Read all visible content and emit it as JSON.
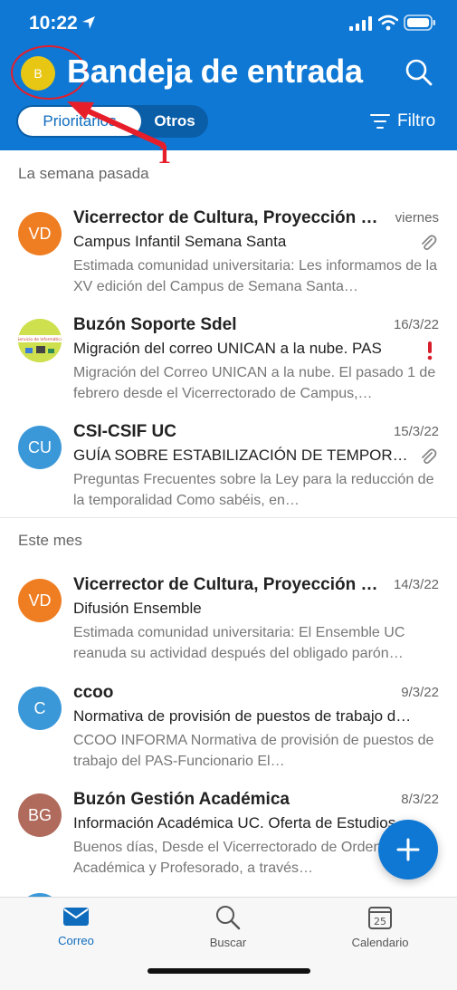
{
  "status_bar": {
    "time": "10:22"
  },
  "header": {
    "avatar_initial": "B",
    "title": "Bandeja de entrada",
    "segments": [
      "Prioritarios",
      "Otros"
    ],
    "filter_label": "Filtro"
  },
  "annotation": {
    "number": "1",
    "color": "#e61e2a"
  },
  "sections": [
    {
      "title": "La semana pasada"
    },
    {
      "title": "Este mes"
    }
  ],
  "emails": [
    {
      "initials": "VD",
      "avatar_color": "#ef7d22",
      "sender": "Vicerrector de Cultura, Proyección Social",
      "date": "viernes",
      "subject": "Campus Infantil Semana Santa",
      "preview": "Estimada comunidad universitaria: Les informamos de la XV edición del Campus de Semana Santa…",
      "attachment": true,
      "important": false
    },
    {
      "initials": "",
      "avatar_color": "#c8d94a",
      "avatar_image_text": "Servicio de Informática",
      "sender": "Buzón Soporte Sdel",
      "date": "16/3/22",
      "subject": " Migración del correo UNICAN a la nube. PAS",
      "preview": "Migración del Correo UNICAN a la nube. El pasado 1 de febrero desde el Vicerrectorado de Campus,…",
      "attachment": false,
      "important": true
    },
    {
      "initials": "CU",
      "avatar_color": "#3b98d8",
      "sender": "CSI-CSIF UC",
      "date": "15/3/22",
      "subject": "GUÍA SOBRE ESTABILIZACIÓN DE TEMPORALIDAD",
      "preview": "Preguntas Frecuentes sobre la Ley para la reducción de la temporalidad Como sabéis, en…",
      "attachment": true,
      "important": false
    },
    {
      "initials": "VD",
      "avatar_color": "#ef7d22",
      "sender": "Vicerrector de Cultura, Proyección Social",
      "date": "14/3/22",
      "subject": "Difusión Ensemble",
      "preview": "Estimada comunidad universitaria: El Ensemble UC reanuda su actividad después del obligado parón…",
      "attachment": false,
      "important": false
    },
    {
      "initials": "C",
      "avatar_color": "#3b98d8",
      "sender": "ccoo",
      "date": "9/3/22",
      "subject": "Normativa de provisión de puestos de trabajo del PAS",
      "preview": "CCOO INFORMA Normativa de provisión de puestos de trabajo del PAS-Funcionario El…",
      "attachment": false,
      "important": false
    },
    {
      "initials": "BG",
      "avatar_color": "#b06b5c",
      "sender": "Buzón Gestión Académica",
      "date": "8/3/22",
      "subject": "Información Académica UC. Oferta de Estudios",
      "preview": "Buenos días, Desde el Vicerrectorado de Ordenación Académica y Profesorado, a través…",
      "attachment": false,
      "important": false
    }
  ],
  "tabbar": {
    "items": [
      "Correo",
      "Buscar",
      "Calendario"
    ],
    "calendar_day": "25"
  },
  "colors": {
    "brand": "#0f78d4",
    "accent_text": "#0f6cbd"
  }
}
